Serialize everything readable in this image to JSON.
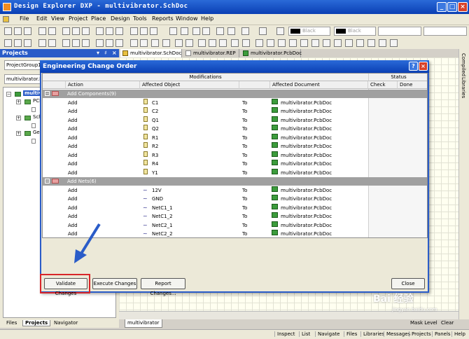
{
  "app": {
    "title": "Design Explorer DXP - multivibrator.SchDoc",
    "window_buttons": [
      "_",
      "□",
      "×"
    ]
  },
  "menu": [
    "File",
    "Edit",
    "View",
    "Project",
    "Place",
    "Design",
    "Tools",
    "Reports",
    "Window",
    "Help"
  ],
  "toolbar": {
    "color1_label": "Black",
    "color2_label": "Black"
  },
  "projects_panel": {
    "title": "Projects",
    "field1": "ProjectGroup1",
    "field2": "multivibrator.Pr",
    "tree": [
      {
        "label": "multiv",
        "selected": true
      },
      {
        "label": "PCB",
        "selected": false
      },
      {
        "label": "Sch",
        "selected": false
      },
      {
        "label": "Gen",
        "selected": false
      }
    ],
    "bottom_tabs": [
      "Files",
      "Projects",
      "Navigator"
    ]
  },
  "doc_tabs": [
    {
      "label": "multivibrator.SchDoc",
      "active": true,
      "icon": "schematic-icon"
    },
    {
      "label": "multivibrator.REP",
      "active": false,
      "icon": "report-icon"
    },
    {
      "label": "multivibrator.PcbDoc",
      "active": false,
      "icon": "pcb-icon"
    }
  ],
  "right_dock": [
    "Compiled",
    "Libraries"
  ],
  "sheet_tab": "multivibrator",
  "mask_level": "Mask Level",
  "clear_label": "Clear",
  "status_bar": [
    "Inspect",
    "List",
    "Navigate",
    "Files",
    "Libraries",
    "Messages",
    "Projects",
    "Panels",
    "Help"
  ],
  "dialog": {
    "title": "Engineering Change Order",
    "help_button": "?",
    "close_button": "×",
    "header": {
      "modifications": "Modifications",
      "status": "Status",
      "columns": [
        "Action",
        "Affected Object",
        "Affected Document",
        "Check",
        "Done"
      ]
    },
    "groups": [
      {
        "label": "Add Components(9)",
        "rows": [
          {
            "action": "Add",
            "object": "C1",
            "to": "To",
            "document": "multivibrator.PcbDoc"
          },
          {
            "action": "Add",
            "object": "C2",
            "to": "To",
            "document": "multivibrator.PcbDoc"
          },
          {
            "action": "Add",
            "object": "Q1",
            "to": "To",
            "document": "multivibrator.PcbDoc"
          },
          {
            "action": "Add",
            "object": "Q2",
            "to": "To",
            "document": "multivibrator.PcbDoc"
          },
          {
            "action": "Add",
            "object": "R1",
            "to": "To",
            "document": "multivibrator.PcbDoc"
          },
          {
            "action": "Add",
            "object": "R2",
            "to": "To",
            "document": "multivibrator.PcbDoc"
          },
          {
            "action": "Add",
            "object": "R3",
            "to": "To",
            "document": "multivibrator.PcbDoc"
          },
          {
            "action": "Add",
            "object": "R4",
            "to": "To",
            "document": "multivibrator.PcbDoc"
          },
          {
            "action": "Add",
            "object": "Y1",
            "to": "To",
            "document": "multivibrator.PcbDoc"
          }
        ]
      },
      {
        "label": "Add Nets(6)",
        "rows": [
          {
            "action": "Add",
            "object": "12V",
            "to": "To",
            "document": "multivibrator.PcbDoc"
          },
          {
            "action": "Add",
            "object": "GND",
            "to": "To",
            "document": "multivibrator.PcbDoc"
          },
          {
            "action": "Add",
            "object": "NetC1_1",
            "to": "To",
            "document": "multivibrator.PcbDoc"
          },
          {
            "action": "Add",
            "object": "NetC1_2",
            "to": "To",
            "document": "multivibrator.PcbDoc"
          },
          {
            "action": "Add",
            "object": "NetC2_1",
            "to": "To",
            "document": "multivibrator.PcbDoc"
          },
          {
            "action": "Add",
            "object": "NetC2_2",
            "to": "To",
            "document": "multivibrator.PcbDoc"
          }
        ]
      }
    ],
    "buttons": {
      "validate": "Validate Changes",
      "execute": "Execute Changes",
      "report": "Report Changes...",
      "close": "Close"
    }
  },
  "watermark": "Bai 经验",
  "watermark_url": "jingyan.baidu.com",
  "colors": {
    "titlebar": "#0a3fb4",
    "highlight_box": "#d8262a",
    "arrow": "#2a5cc8"
  }
}
